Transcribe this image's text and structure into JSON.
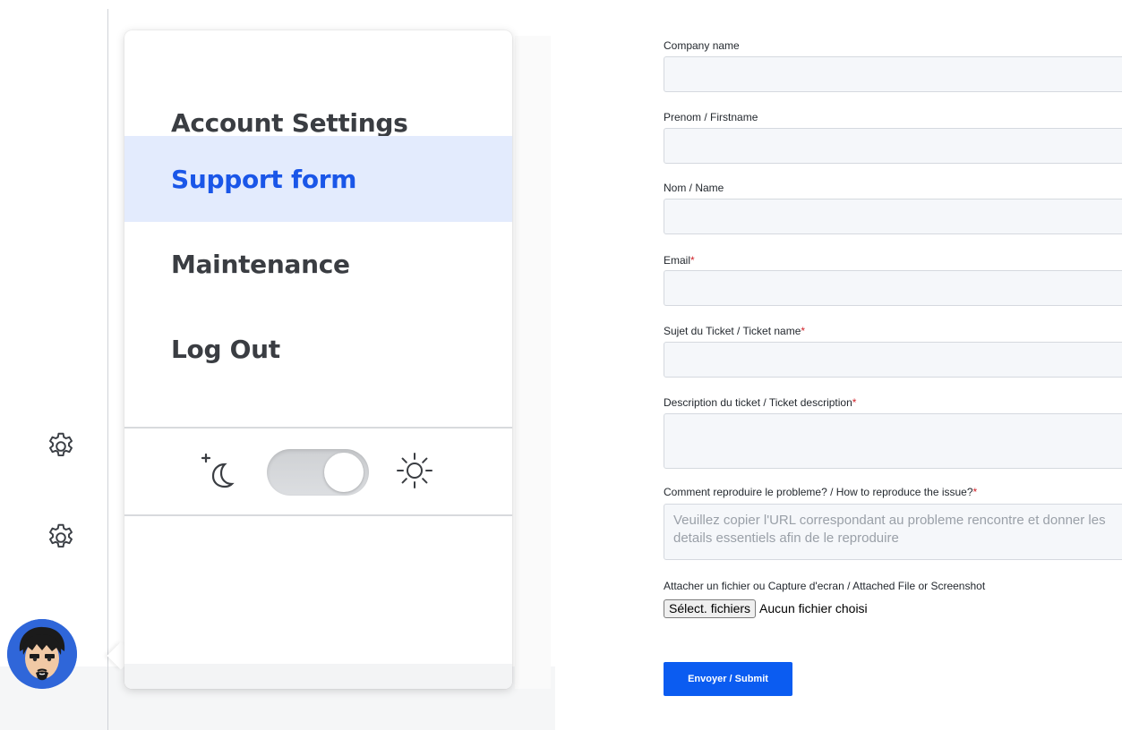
{
  "menu": {
    "items": [
      {
        "label": "Account Settings"
      },
      {
        "label": "Support form",
        "active": true
      },
      {
        "label": "Maintenance"
      },
      {
        "label": "Log Out"
      }
    ],
    "theme_toggle": {
      "dark_icon": "moon-icon",
      "light_icon": "sun-icon"
    }
  },
  "rail": {
    "icons": [
      "gear-icon",
      "gear-icon"
    ],
    "avatar": "avatar"
  },
  "form": {
    "fields": [
      {
        "label": "Company name",
        "required": false,
        "value": ""
      },
      {
        "label": "Prenom / Firstname",
        "required": false,
        "value": ""
      },
      {
        "label": "Nom / Name",
        "required": false,
        "value": ""
      },
      {
        "label": "Email",
        "required": true,
        "value": ""
      },
      {
        "label": "Sujet du Ticket / Ticket name",
        "required": true,
        "value": ""
      },
      {
        "label": "Description du ticket / Ticket description",
        "required": true,
        "value": ""
      },
      {
        "label": "Comment reproduire le probleme? / How to reproduce the issue?",
        "required": true,
        "placeholder": "Veuillez copier l'URL correspondant au probleme rencontre et donner les details essentiels afin de le reproduire"
      }
    ],
    "required_marker": "*",
    "file": {
      "label": "Attacher un fichier ou Capture d'ecran / Attached File or Screenshot",
      "button": "Sélect. fichiers",
      "status": "Aucun fichier choisi"
    },
    "submit_label": "Envoyer / Submit"
  },
  "colors": {
    "accent": "#1a56e8",
    "active_bg": "#e3ebfd",
    "submit": "#0b5cf1",
    "required": "#d0242b",
    "avatar_bg": "#2f66d9"
  }
}
